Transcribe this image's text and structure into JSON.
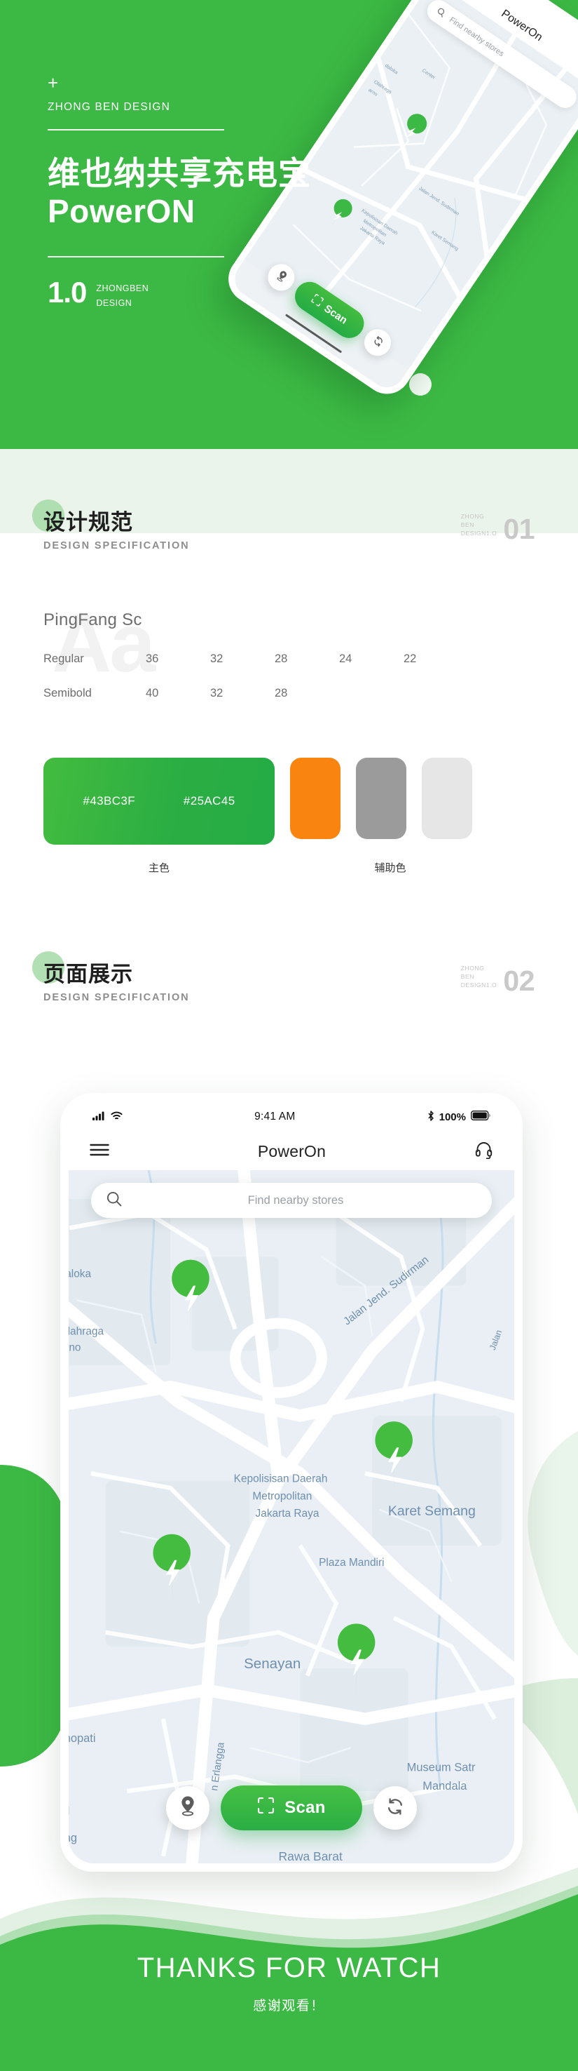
{
  "hero": {
    "plus": "+",
    "brand": "ZHONG BEN DESIGN",
    "title_line1": "维也纳共享充电宝",
    "title_line2": "PowerON",
    "version": "1.0",
    "version_sub_line1": "ZHONGBEN",
    "version_sub_line2": "DESIGN",
    "bg_color": "#3CB944"
  },
  "section_one": {
    "cn": "设计规范",
    "en": "DESIGN SPECIFICATION",
    "index_line1": "ZHONG",
    "index_line2": "BEN",
    "index_line3": "DESIGN1.O",
    "number": "01"
  },
  "typography": {
    "watermark": "Aa",
    "family": "PingFang  Sc",
    "rows": [
      {
        "weight": "Regular",
        "sizes": [
          "36",
          "32",
          "28",
          "24",
          "22"
        ]
      },
      {
        "weight": "Semibold",
        "sizes": [
          "40",
          "32",
          "28"
        ]
      }
    ]
  },
  "colors": {
    "primary_left": "#43BC3F",
    "primary_right": "#25AC45",
    "primary_caption": "主色",
    "aux_caption": "辅助色",
    "aux": [
      "#F98410",
      "#9B9B9B",
      "#E6E6E6"
    ]
  },
  "section_two": {
    "cn": "页面展示",
    "en": "DESIGN SPECIFICATION",
    "index_line1": "ZHONG",
    "index_line2": "BEN",
    "index_line3": "DESIGN1.O",
    "number": "02"
  },
  "phone": {
    "status": {
      "time": "9:41 AM",
      "battery_percent": "100%",
      "signal_icon": "cellular-signal-icon",
      "wifi_icon": "wifi-icon",
      "bluetooth_icon": "bluetooth-icon",
      "battery_icon": "battery-full-icon"
    },
    "nav": {
      "menu_icon": "hamburger-menu-icon",
      "title": "PowerOn",
      "support_icon": "headset-icon"
    },
    "search": {
      "placeholder": "Find nearby stores",
      "icon": "search-icon"
    },
    "map": {
      "labels": [
        "Center",
        "daloka",
        "Olahraga",
        "arno",
        "Jalan Jend. Sudirman",
        "Hilir",
        "Jalan",
        "Kepolisisan Daerah",
        "Metropolitan",
        "Jakarta Raya",
        "Karet Semang",
        "Plaza Mandiri",
        "Senayan",
        "enopati",
        "h",
        "h I",
        "n Erlangga",
        "Museum Satr",
        "Mandala",
        "ong",
        "Ker",
        "a",
        "Rawa Barat",
        "K"
      ],
      "pin_icon": "charging-station-pin-icon",
      "pin_count": 5
    },
    "bottom": {
      "locate_icon": "location-pin-icon",
      "scan_label": "Scan",
      "scan_icon": "qr-scan-icon",
      "refresh_icon": "refresh-icon"
    }
  },
  "footer": {
    "en": "THANKS FOR WATCH",
    "cn": "感谢观看！"
  }
}
